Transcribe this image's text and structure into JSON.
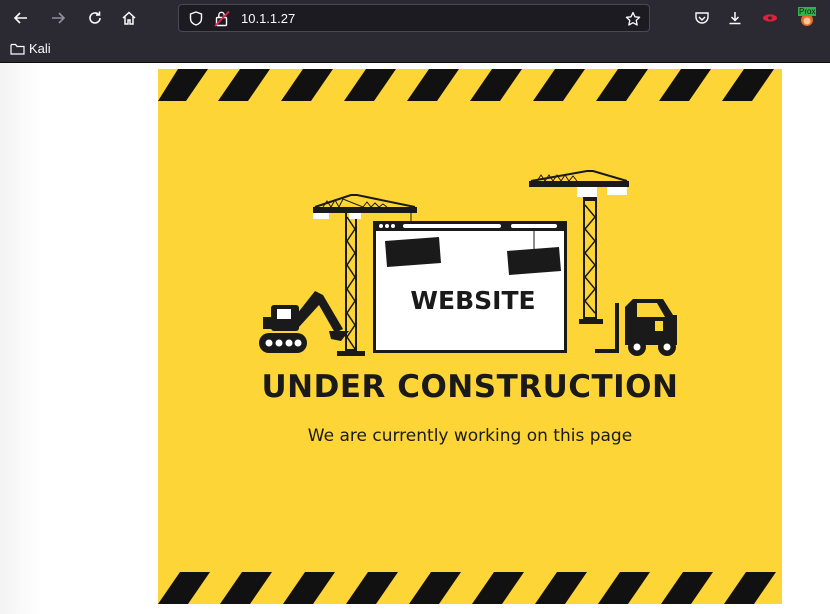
{
  "browser": {
    "url": "10.1.1.27",
    "bookmark_folder": "Kali",
    "extension_badge": "Prox"
  },
  "poster": {
    "browser_word": "WEBSITE",
    "headline": "UNDER CONSTRUCTION",
    "subline": "We are currently working on this page",
    "colors": {
      "background": "#fdd537",
      "ink": "#1a1a1a"
    }
  }
}
